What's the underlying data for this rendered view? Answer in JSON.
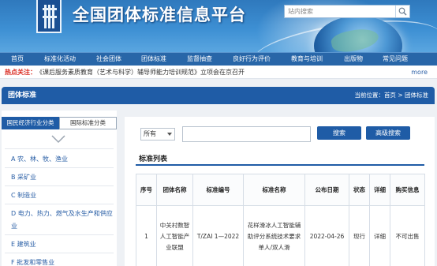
{
  "header": {
    "site_title": "全国团体标准信息平台",
    "search": {
      "placeholder": "站内搜索"
    }
  },
  "nav": {
    "items": [
      {
        "label": "首页"
      },
      {
        "label": "标准化活动"
      },
      {
        "label": "社会团体"
      },
      {
        "label": "团体标准"
      },
      {
        "label": "监督抽查"
      },
      {
        "label": "良好行为评价"
      },
      {
        "label": "教育与培训"
      },
      {
        "label": "出版物"
      },
      {
        "label": "常见问题"
      }
    ]
  },
  "hotbar": {
    "label": "热点关注：",
    "text": "《课后服务素质教育（艺术与科学）辅导师能力培训规范》立项会在京召开",
    "more": "more"
  },
  "section": {
    "title": "团体标准",
    "breadcrumb_prefix": "当前位置：",
    "breadcrumb_home": "首页",
    "breadcrumb_sep": " > ",
    "breadcrumb_current": "团体标准"
  },
  "left": {
    "tabs": [
      {
        "label": "国民经济行业分类"
      },
      {
        "label": "国际标准分类"
      }
    ],
    "categories": [
      {
        "label": "A 农、林、牧、渔业"
      },
      {
        "label": "B 采矿业"
      },
      {
        "label": "C 制造业"
      },
      {
        "label": "D 电力、热力、燃气及水生产和供应业"
      },
      {
        "label": "E 建筑业"
      },
      {
        "label": "F 批发和零售业"
      }
    ]
  },
  "filter": {
    "select_value": "所有",
    "keyword_value": "",
    "search_button": "搜索",
    "advanced_button": "高级搜索"
  },
  "list": {
    "title": "标准列表",
    "columns": [
      "序号",
      "团体名称",
      "标准编号",
      "标准名称",
      "公布日期",
      "状态",
      "详细",
      "购买信息"
    ],
    "rows": [
      {
        "no": "1",
        "org": "中关村数智人工智能产业联盟",
        "code": "T/ZAI 1—2022",
        "name": "花样滑冰人工智能辅助评分系统技术要求 单人/双人滑",
        "date": "2022-04-26",
        "status": "现行",
        "detail": "详细",
        "purchase": "不可出售"
      }
    ]
  },
  "colors": {
    "primary": "#1f5ca6",
    "nav": "#2866a8",
    "hot": "#d9261c",
    "link": "#2a5fa6"
  }
}
